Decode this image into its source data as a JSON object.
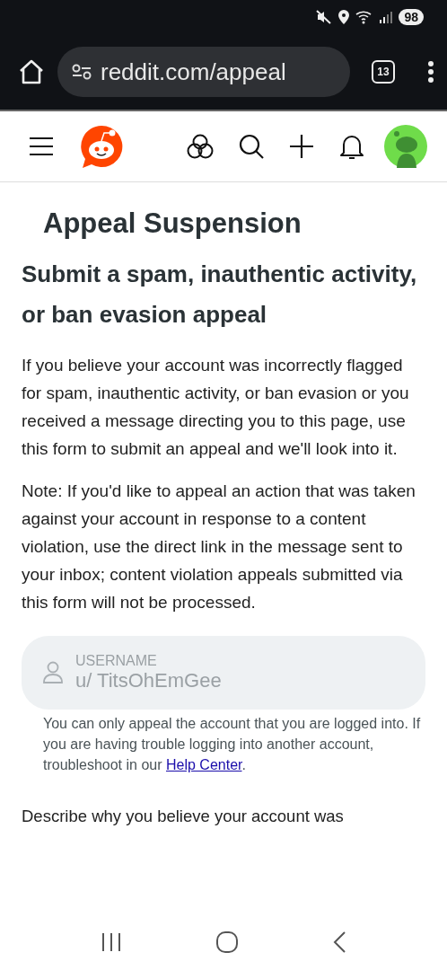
{
  "status_bar": {
    "battery": "98"
  },
  "browser_bar": {
    "url": "reddit.com/appeal",
    "tab_count": "13"
  },
  "page": {
    "title": "Appeal Suspension",
    "heading": "Submit a spam, inauthentic activity, or ban evasion appeal",
    "paragraphs": [
      "If you believe your account was incorrectly flagged for spam, inauthentic activity, or ban evasion or you received a message directing you to this page, use this form to submit an appeal and we'll look into it.",
      "Note: If you'd like to appeal an action that was taken against your account in response to a content violation, use the direct link in the message sent to your inbox; content violation appeals submitted via this form will not be processed."
    ],
    "username_field": {
      "label": "USERNAME",
      "value": "u/ TitsOhEmGee"
    },
    "help_text": {
      "text": "You can only appeal the account that you are logged into. If you are having trouble logging into another account, troubleshoot in our ",
      "link": "Help Center",
      "after": "."
    },
    "next_prompt": "Describe why you believe your account was"
  }
}
